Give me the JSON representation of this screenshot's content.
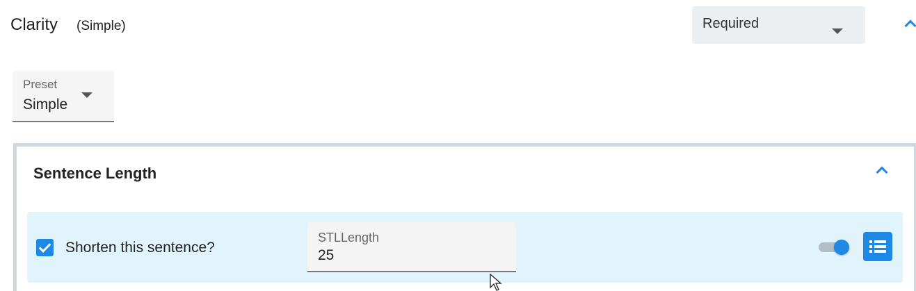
{
  "header": {
    "title": "Clarity",
    "subtitle": "(Simple)",
    "requirement_select": {
      "value": "Required"
    }
  },
  "preset": {
    "label": "Preset",
    "value": "Simple"
  },
  "card": {
    "title": "Sentence Length",
    "rule": {
      "checked": true,
      "label": "Shorten this sentence?",
      "param_label": "STLLength",
      "param_value": "25",
      "toggle_on": true
    }
  },
  "colors": {
    "accent": "#1e88e5",
    "row_bg": "#e1f4fb",
    "select_bg": "#eceff1",
    "card_border": "#cfd8dc"
  },
  "icons": {
    "collapse": "chevron-up-icon",
    "dropdown": "caret-down-icon",
    "list": "list-icon",
    "check": "check-icon",
    "cursor": "mouse-pointer-icon"
  }
}
